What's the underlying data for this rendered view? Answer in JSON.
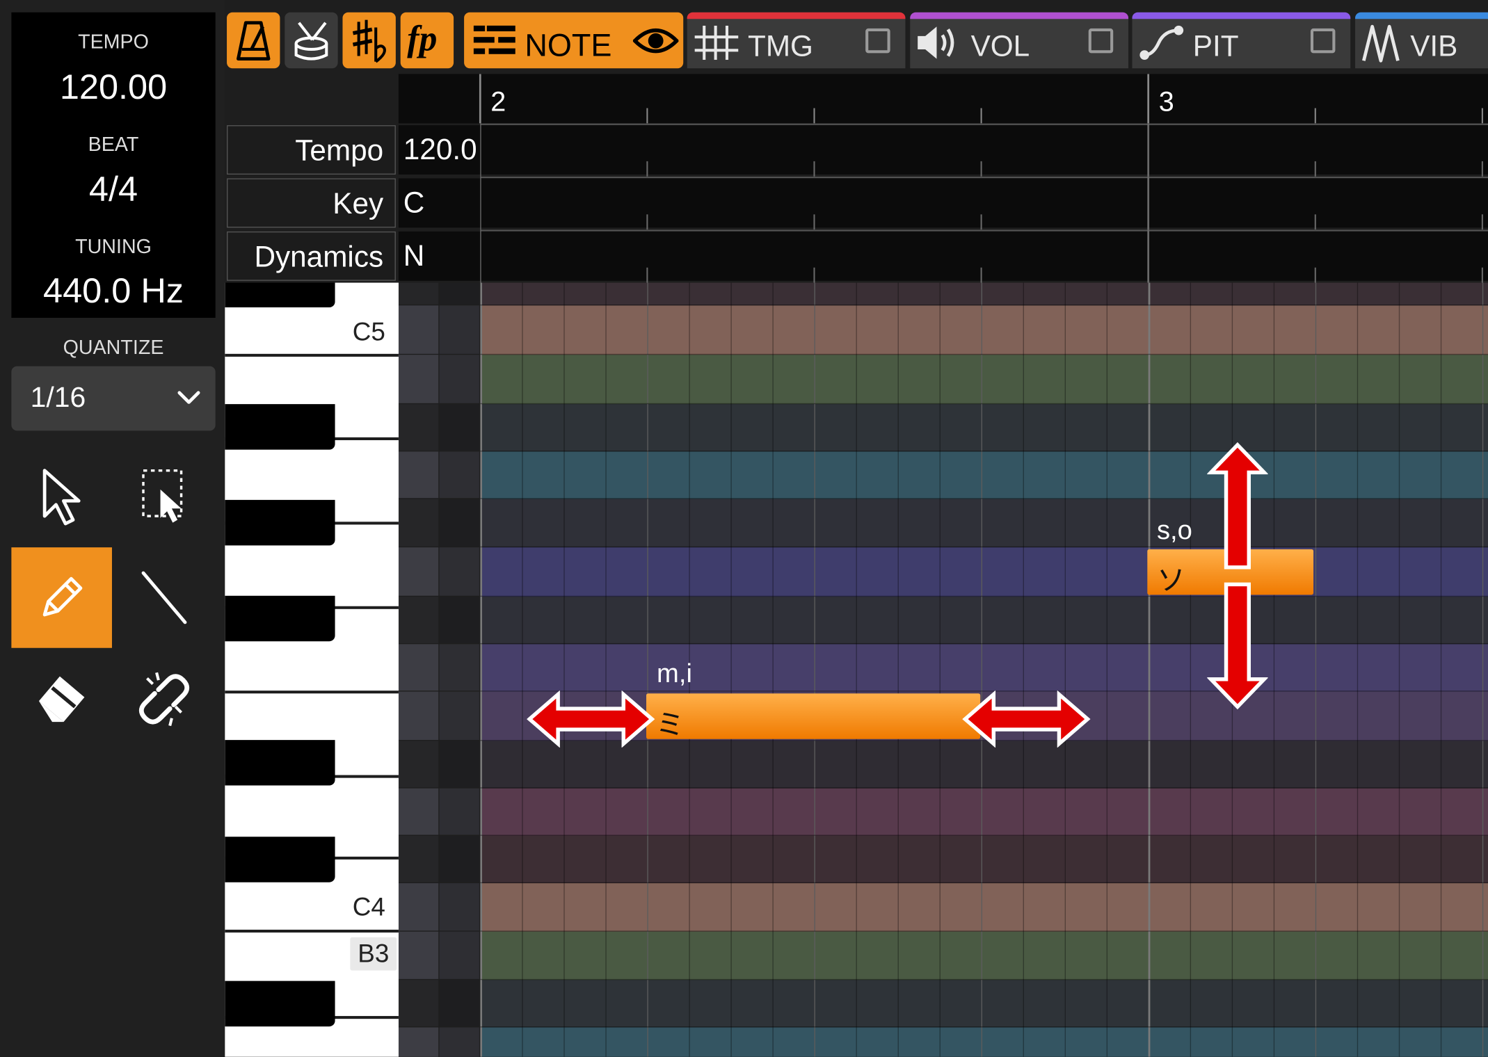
{
  "info": {
    "tempo_label": "TEMPO",
    "tempo_value": "120.00",
    "beat_label": "BEAT",
    "beat_value": "4/4",
    "tuning_label": "TUNING",
    "tuning_value": "440.0 Hz"
  },
  "quantize": {
    "label": "QUANTIZE",
    "value": "1/16"
  },
  "tabs": {
    "note": "NOTE",
    "tmg": "TMG",
    "vol": "VOL",
    "pit": "PIT",
    "vib": "VIB"
  },
  "colors": {
    "accent": "#f0901e",
    "tmg": "#e0323a",
    "vol": "#b050d0",
    "pit": "#8a5ae8",
    "vib": "#3a8ae0"
  },
  "ruler": {
    "measure_2": "2",
    "measure_3": "3"
  },
  "header_rows": [
    {
      "label": "Tempo",
      "value": "120.0"
    },
    {
      "label": "Key",
      "value": "C"
    },
    {
      "label": "Dynamics",
      "value": "N"
    }
  ],
  "piano_labels": {
    "c5": "C5",
    "c4": "C4",
    "b3": "B3"
  },
  "notes": [
    {
      "lyric": "ミ",
      "phoneme": "m,i"
    },
    {
      "lyric": "ソ",
      "phoneme": "s,o"
    }
  ]
}
